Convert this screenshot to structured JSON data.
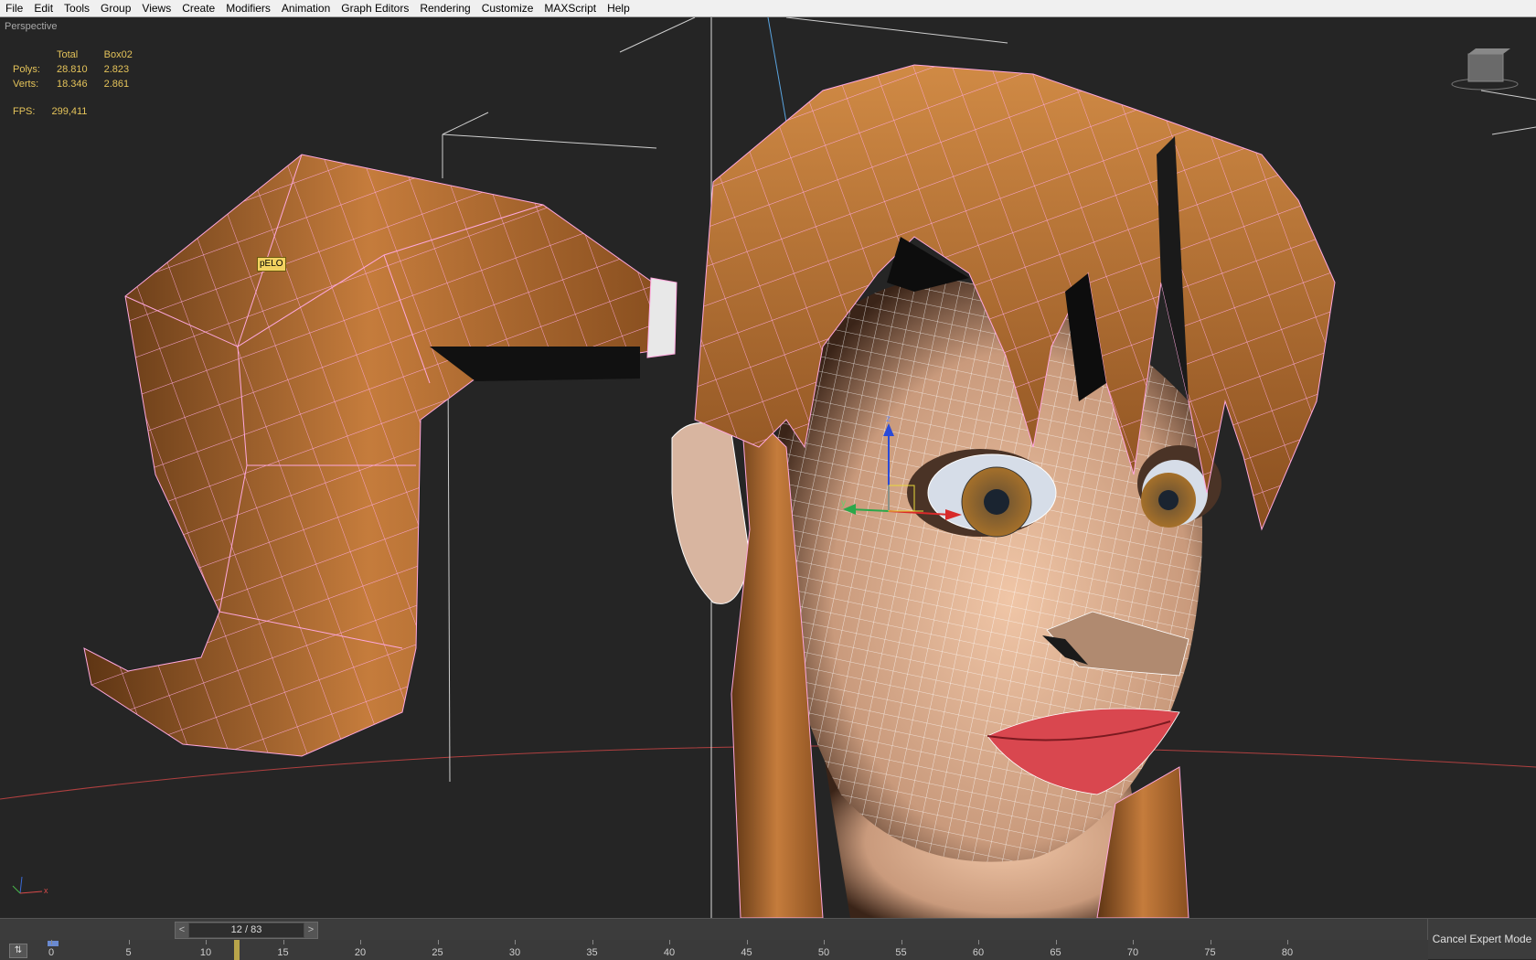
{
  "menu": [
    "File",
    "Edit",
    "Tools",
    "Group",
    "Views",
    "Create",
    "Modifiers",
    "Animation",
    "Graph Editors",
    "Rendering",
    "Customize",
    "MAXScript",
    "Help"
  ],
  "viewport": {
    "label": "Perspective",
    "object_tag": "pELO",
    "axis_labels": {
      "z": "z",
      "y": "y",
      "x": "x"
    }
  },
  "stats": {
    "header_total": "Total",
    "header_object": "Box02",
    "polys_label": "Polys:",
    "polys_total": "28.810",
    "polys_object": "2.823",
    "verts_label": "Verts:",
    "verts_total": "18.346",
    "verts_object": "2.861",
    "fps_label": "FPS:",
    "fps_value": "299,411"
  },
  "timeline": {
    "frame_label": "12 / 83",
    "prev": "<",
    "next": ">",
    "cancel_expert_mode": "Cancel Expert Mode",
    "ticks": [
      "0",
      "5",
      "10",
      "15",
      "20",
      "25",
      "30",
      "35",
      "40",
      "45",
      "50",
      "55",
      "60",
      "65",
      "70",
      "75",
      "80"
    ],
    "current_frame": 12
  },
  "colors": {
    "viewport_bg": "#252525",
    "stats_text": "#e4c35a",
    "hair": "#c47a3a",
    "skin": "#e9b898",
    "wire_pink": "#ffb0e0",
    "lips": "#d9474f"
  }
}
